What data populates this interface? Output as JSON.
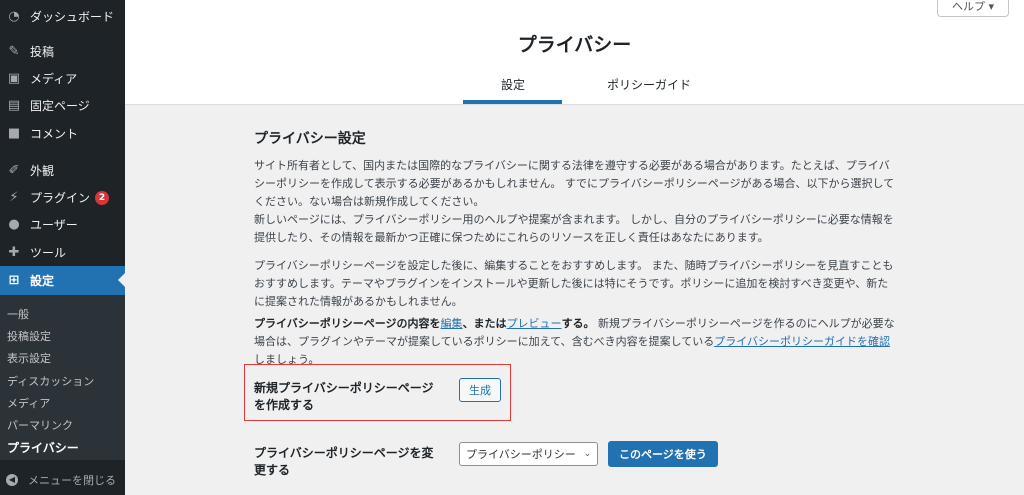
{
  "sidebar": {
    "items": [
      {
        "label": "ダッシュボード",
        "icon": "dashboard-icon"
      },
      {
        "label": "投稿",
        "icon": "pin-icon"
      },
      {
        "label": "メディア",
        "icon": "media-icon"
      },
      {
        "label": "固定ページ",
        "icon": "page-icon"
      },
      {
        "label": "コメント",
        "icon": "comment-icon"
      },
      {
        "label": "外観",
        "icon": "brush-icon"
      },
      {
        "label": "プラグイン",
        "icon": "plugin-icon",
        "badge": "2"
      },
      {
        "label": "ユーザー",
        "icon": "user-icon"
      },
      {
        "label": "ツール",
        "icon": "wrench-icon"
      },
      {
        "label": "設定",
        "icon": "settings-icon"
      }
    ],
    "submenu": [
      "一般",
      "投稿設定",
      "表示設定",
      "ディスカッション",
      "メディア",
      "パーマリンク",
      "プライバシー"
    ],
    "collapse_label": "メニューを閉じる"
  },
  "header": {
    "help_label": "ヘルプ ▾",
    "title": "プライバシー",
    "tabs": [
      "設定",
      "ポリシーガイド"
    ]
  },
  "main": {
    "section_title": "プライバシー設定",
    "p1": "サイト所有者として、国内または国際的なプライバシーに関する法律を遵守する必要がある場合があります。たとえば、プライバシーポリシーを作成して表示する必要があるかもしれません。 すでにプライバシーポリシーページがある場合、以下から選択してください。ない場合は新規作成してください。",
    "p2": "新しいページには、プライバシーポリシー用のヘルプや提案が含まれます。 しかし、自分のプライバシーポリシーに必要な情報を提供したり、その情報を最新かつ正確に保つためにこれらのリソースを正しく責任はあなたにあります。",
    "p3": "プライバシーポリシーページを設定した後に、編集することをおすすめします。 また、随時プライバシーポリシーを見直すこともおすすめします。テーマやプラグインをインストールや更新した後には特にそうです。ポリシーに追加を検討すべき変更や、新たに提案された情報があるかもしれません。",
    "p4_bold_a": "プライバシーポリシーページの内容を",
    "p4_link_edit": "編集",
    "p4_bold_b": "、または",
    "p4_link_preview": "プレビュー",
    "p4_bold_c": "する。",
    "p4_text": " 新規プライバシーポリシーページを作るのにヘルプが必要な場合は、プラグインやテーマが提案しているポリシーに加えて、含むべき内容を提案している",
    "p4_link_guide": "プライバシーポリシーガイドを確認",
    "p4_end": "しましょう。",
    "create_label": "新規プライバシーポリシーページを作成する",
    "create_button": "生成",
    "change_label": "プライバシーポリシーページを変更する",
    "select_value": "プライバシーポリシー",
    "use_button": "このページを使う"
  }
}
